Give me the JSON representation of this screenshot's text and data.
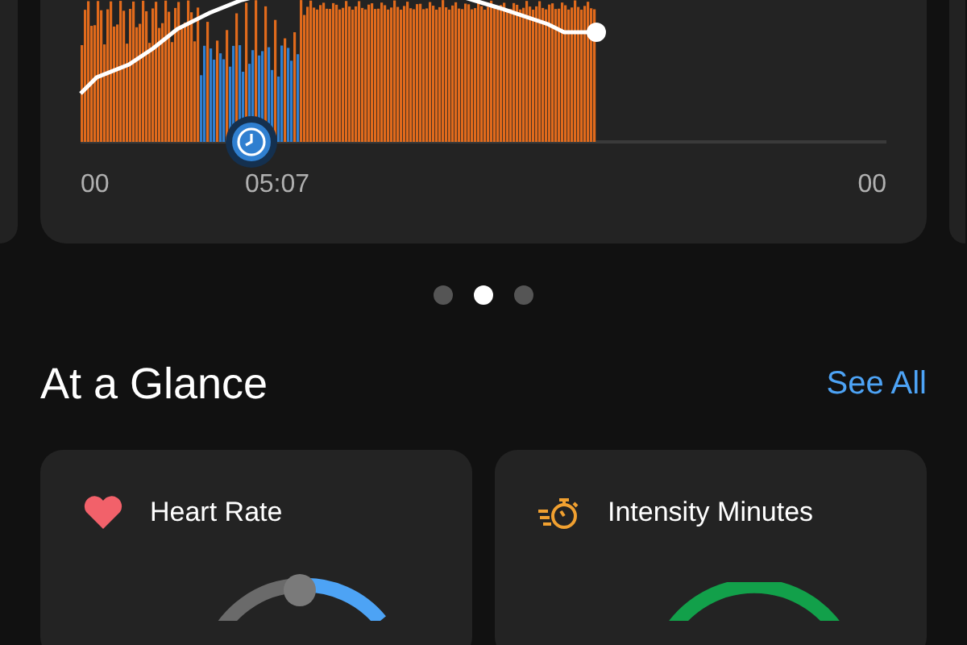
{
  "chart": {
    "x_start": "00",
    "marker_label": "05:07",
    "x_end": "00"
  },
  "pager": [
    {
      "selected": false
    },
    {
      "selected": true
    },
    {
      "selected": false
    }
  ],
  "section": {
    "title": "At a Glance",
    "link": "See All"
  },
  "cards": [
    {
      "kind": "heart_rate",
      "title": "Heart Rate"
    },
    {
      "kind": "intensity",
      "title": "Intensity Minutes"
    }
  ]
}
